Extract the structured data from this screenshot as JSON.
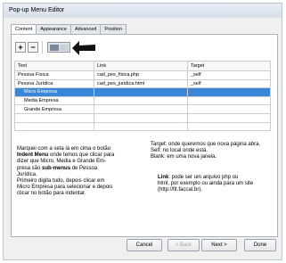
{
  "window": {
    "title": "Pop-up Menu Editor"
  },
  "tabs": [
    {
      "label": "Content"
    },
    {
      "label": "Appearance"
    },
    {
      "label": "Advanced"
    },
    {
      "label": "Position"
    }
  ],
  "toolbar": {
    "add_label": "+",
    "remove_label": "−"
  },
  "table": {
    "columns": [
      "Text",
      "Link",
      "Target"
    ],
    "rows": [
      {
        "text": "Pessoa Física",
        "link": "cad_pes_fisica.php",
        "target": "_self"
      },
      {
        "text": "Pessoa Jurídica",
        "link": "cad_pes_juridica.html",
        "target": "_self"
      },
      {
        "text": "Micro Empresa",
        "link": "",
        "target": "",
        "selected": true
      },
      {
        "text": "Media Empresa",
        "link": "",
        "target": ""
      },
      {
        "text": "Grande Empresa",
        "link": "",
        "target": ""
      }
    ]
  },
  "notes": {
    "left": {
      "line1": "Marquei com a seta lá em cima o botão",
      "line2a": "Indent Menu",
      "line2b": " onde temos que clicar para",
      "line3": "dizer que Micro, Media e Grande Em-",
      "line4a": "presa são ",
      "line4b": "sub-menus",
      "line4c": " de Pessoa",
      "line5": "Jurídica.",
      "line6": "Primeiro digita tudo, depois clicar em",
      "line7": "Micro Empresa para selecionar e depois",
      "line8": "clicar no botão para indentar."
    },
    "right_top": {
      "line1": "Target: onde queremos que nova página abra.",
      "line2": "Self: no local onde está.",
      "line3": "Blank: em uma nova janela."
    },
    "right_bottom": {
      "line1a": "Link",
      "line1b": ": pode ser um arquivo php ou",
      "line2": "html, por exemplo ou ainda para um site",
      "line3": "(http://fit.faccat.br)."
    }
  },
  "footer": {
    "cancel": "Cancel",
    "back": "< Back",
    "next": "Next >",
    "done": "Done"
  }
}
